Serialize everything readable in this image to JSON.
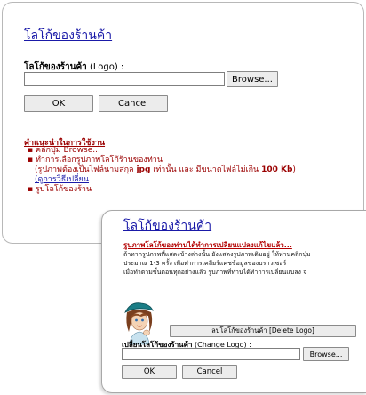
{
  "back_panel": {
    "title": "โลโก้ของร้านค้า",
    "logo_label_bold": "โลโก้ของร้านค้า",
    "logo_label_rest": " (Logo) :",
    "browse_label": "Browse...",
    "ok_label": "OK",
    "cancel_label": "Cancel",
    "help_title": "คำแนะนำในการใช้งาน",
    "help_item_1": "คลิกปุ่ม Browse...",
    "help_item_2": "ทำการเลือกรูปภาพโลโก้ร้านของท่าน",
    "help_item_2_sub_pre": "(รูปภาพต้องเป็นไฟล์นามสกุล ",
    "help_item_2_sub_ext": "jpg",
    "help_item_2_sub_mid": " เท่านั้น และ มีขนาดไฟล์ไม่เกิน ",
    "help_item_2_sub_size": "100 Kb",
    "help_item_2_sub_end": ")",
    "help_item_2_link": "(ดูการวิธีเปลี่ยน",
    "help_item_3": "รูปโลโก้ของร้าน"
  },
  "front_panel": {
    "title": "โลโก้ของร้านค้า",
    "notice_title": "รูปภาพโลโก้ของท่านได้ทำการเปลี่ยนแปลงแก้ไขแล้ว...",
    "notice_line_1": "ถ้าหากรูปภาพที่แสดงข้างล่างนั้น ยังแสดงรูปภาพเดิมอยู่ ให้ท่านคลิกปุ่ม",
    "notice_line_2": "ประมาณ 1-3 ครั้ง เพื่อทำการเคลียร์แคชข้อมูลของบราวเซอร์",
    "notice_line_3": "เมื่อทำตามขั้นตอนทุกอย่างแล้ว รูปภาพที่ท่านได้ทำการเปลี่ยนแปลง จ",
    "delete_label": "ลบโลโก้ของร้านค้า [Delete Logo]",
    "change_label_bold": "เปลี่ยนโลโก้ของร้านค้า",
    "change_label_rest": " (Change Logo) :",
    "browse_label": "Browse...",
    "ok_label": "OK",
    "cancel_label": "Cancel"
  },
  "colors": {
    "link_blue": "#1a1aa8",
    "help_red": "#9b0000",
    "notice_red": "#b30000"
  },
  "icons": {
    "avatar": "cartoon-girl-avatar"
  }
}
